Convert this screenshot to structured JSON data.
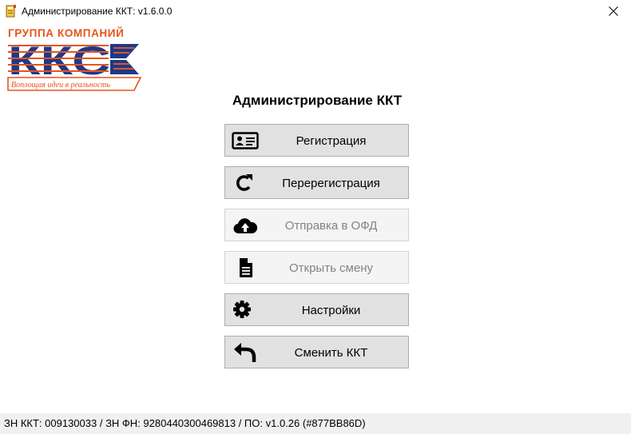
{
  "window": {
    "title": "Администрирование ККТ: v1.6.0.0"
  },
  "logo": {
    "group_text": "ГРУППА КОМПАНИЙ",
    "brand_text": "ККС",
    "slogan": "Воплощая идеи в реальность",
    "colors": {
      "orange": "#e8531c",
      "navy": "#1c3a8c"
    }
  },
  "main": {
    "heading": "Администрирование ККТ",
    "buttons": [
      {
        "label": "Регистрация",
        "icon": "id-card-icon",
        "enabled": true
      },
      {
        "label": "Перерегистрация",
        "icon": "refresh-icon",
        "enabled": true
      },
      {
        "label": "Отправка в ОФД",
        "icon": "cloud-upload-icon",
        "enabled": false
      },
      {
        "label": "Открыть смену",
        "icon": "document-icon",
        "enabled": false
      },
      {
        "label": "Настройки",
        "icon": "gear-icon",
        "enabled": true
      },
      {
        "label": "Сменить ККТ",
        "icon": "back-arrow-icon",
        "enabled": true
      }
    ]
  },
  "status": {
    "text": "ЗН ККТ: 009130033 / ЗН ФН: 9280440300469813 / ПО: v1.0.26 (#877BB86D)"
  }
}
